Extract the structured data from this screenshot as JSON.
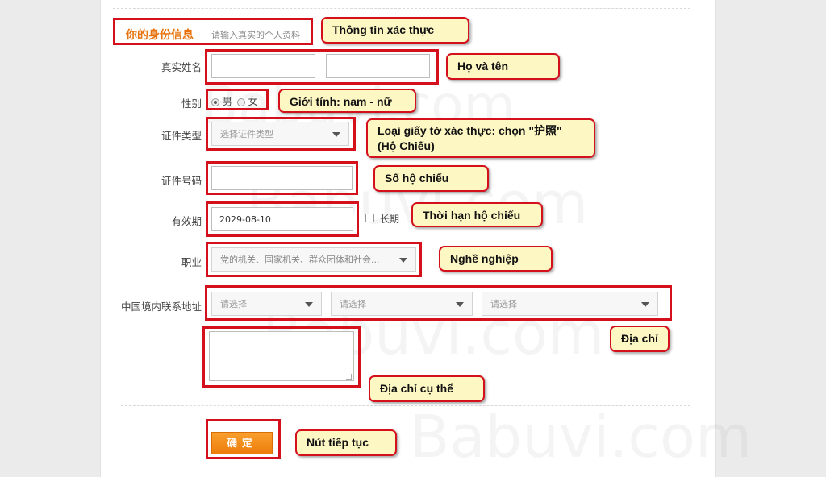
{
  "section": {
    "title": "你的身份信息",
    "subtitle": "请输入真实的个人资料"
  },
  "form": {
    "name_label": "真实姓名",
    "gender_label": "性别",
    "gender_options": [
      "男",
      "女"
    ],
    "gender_selected": "男",
    "id_type_label": "证件类型",
    "id_type_placeholder": "选择证件类型",
    "id_number_label": "证件号码",
    "validity_label": "有效期",
    "validity_value": "2029-08-10",
    "long_term_label": "长期",
    "occupation_label": "职业",
    "occupation_value": "党的机关、国家机关、群众团体和社会...",
    "address_label": "中国境内联系地址",
    "address_selects": [
      "请选择",
      "请选择",
      "请选择"
    ],
    "confirm_label": "确定"
  },
  "annotations": {
    "identity_info": "Thông tin xác thực",
    "full_name": "Họ và tên",
    "gender": "Giới tính: nam - nữ",
    "id_type_line1": "Loại giấy tờ xác thực: chọn \"护照\"",
    "id_type_line2": "(Hộ Chiếu)",
    "passport_number": "Số hộ chiếu",
    "passport_expiry": "Thời hạn hộ chiếu",
    "occupation": "Nghề nghiệp",
    "address": "Địa chỉ",
    "address_detail": "Địa chỉ cụ thể",
    "continue_button": "Nút tiếp tục"
  },
  "watermark": "Babuvi.com",
  "colors": {
    "highlight_border": "#d5101d",
    "note_background": "#fdf7c3",
    "button_orange": "#f18a1b",
    "section_title": "#e8730c"
  }
}
